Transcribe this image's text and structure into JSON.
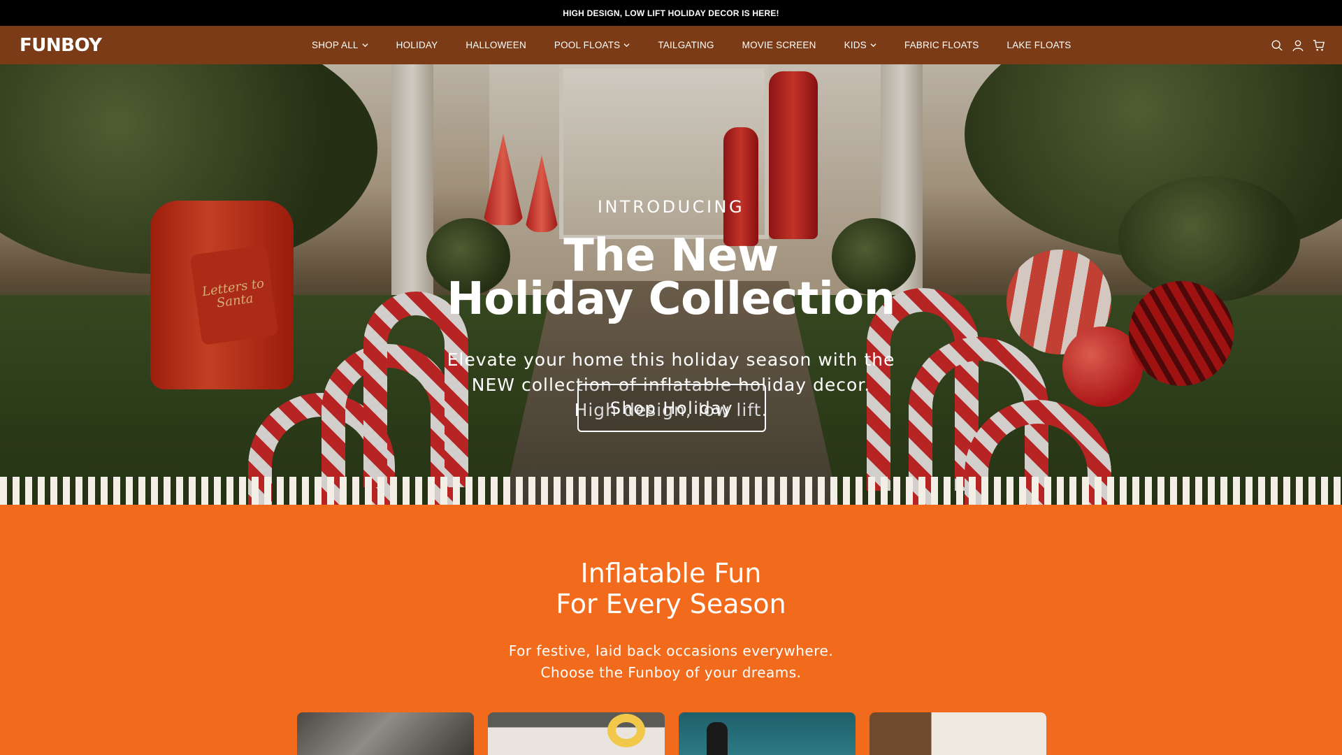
{
  "announcement": "HIGH DESIGN, LOW LIFT HOLIDAY DECOR IS HERE!",
  "brand": {
    "logo": "FUNBOY"
  },
  "nav": {
    "items": [
      {
        "label": "SHOP ALL",
        "dropdown": true
      },
      {
        "label": "HOLIDAY",
        "dropdown": false
      },
      {
        "label": "HALLOWEEN",
        "dropdown": false
      },
      {
        "label": "POOL FLOATS",
        "dropdown": true
      },
      {
        "label": "TAILGATING",
        "dropdown": false
      },
      {
        "label": "MOVIE SCREEN",
        "dropdown": false
      },
      {
        "label": "KIDS",
        "dropdown": true
      },
      {
        "label": "FABRIC FLOATS",
        "dropdown": false
      },
      {
        "label": "LAKE FLOATS",
        "dropdown": false
      }
    ],
    "icons": [
      "search-icon",
      "account-icon",
      "cart-icon"
    ]
  },
  "hero": {
    "eyebrow": "INTRODUCING",
    "title_line1": "The New",
    "title_line2": "Holiday Collection",
    "subtitle_line1": "Elevate your home this holiday season with the",
    "subtitle_line2": "NEW collection of inflatable holiday decor.",
    "subtitle_line3": "High design, low lift.",
    "cta": "Shop Holiday",
    "mailbox_text": "Letters to Santa"
  },
  "section": {
    "title_line1": "Inflatable Fun",
    "title_line2": "For Every Season",
    "subtitle_line1": "For festive, laid back occasions everywhere.",
    "subtitle_line2": "Choose the Funboy of your dreams."
  },
  "colors": {
    "announcement_bg": "#000000",
    "header_bg": "#7a3b16",
    "section_bg": "#f26a1b",
    "text": "#ffffff"
  }
}
